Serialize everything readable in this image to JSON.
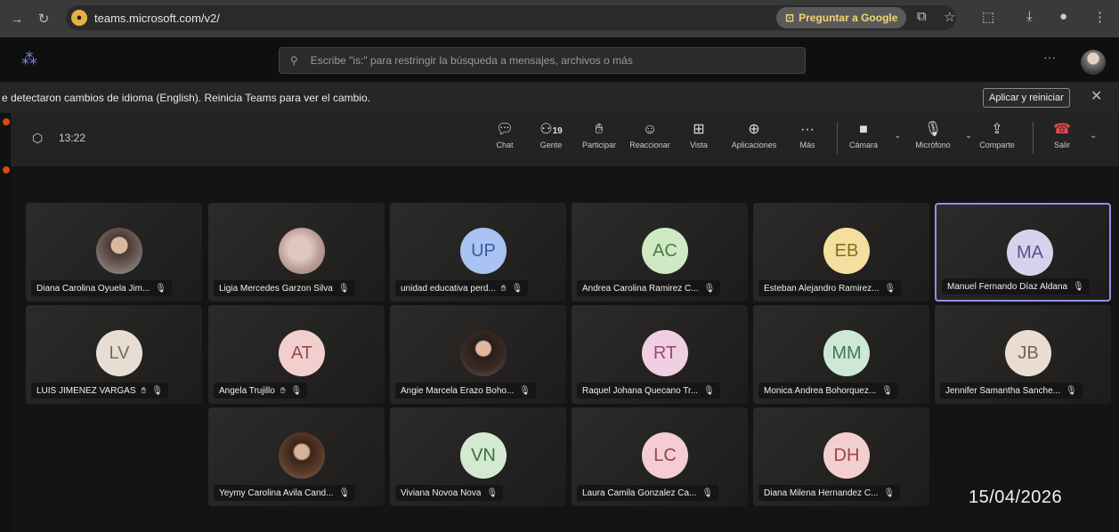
{
  "browser": {
    "url": "teams.microsoft.com/v2/",
    "google_button": "Preguntar a Google"
  },
  "teams": {
    "search_placeholder": "Escribe \"is:\" para restringir la búsqueda a mensajes, archivos o más",
    "more": "···"
  },
  "banner": {
    "message": "e detectaron cambios de idioma (English). Reinicia Teams para ver el cambio.",
    "apply_label": "Aplicar y reiniciar",
    "close": "✕"
  },
  "meeting": {
    "timer": "13:22",
    "controls": {
      "chat": "Chat",
      "people_count": "19",
      "people": "Gente",
      "raise": "Participar",
      "react": "Reaccionar",
      "view": "Vista",
      "apps": "Aplicaciones",
      "more": "Más",
      "camera": "Cámara",
      "mic": "Micrófono",
      "share": "Comparte",
      "leave": "Salir"
    }
  },
  "participants": [
    {
      "name": "Diana Carolina Oyuela Jim...",
      "avatar_type": "photo",
      "initials": "",
      "hand": false
    },
    {
      "name": "Ligia Mercedes Garzon Silva",
      "avatar_type": "photo2",
      "initials": "",
      "hand": false
    },
    {
      "name": "unidad educativa perd...",
      "avatar_type": "initials",
      "initials": "UP",
      "color": "#a9c3f2",
      "text_color": "#3a5a99",
      "hand": true
    },
    {
      "name": "Andrea Carolina Ramirez C...",
      "avatar_type": "initials",
      "initials": "AC",
      "color": "#cfe9c5",
      "text_color": "#4b7a3d",
      "hand": false
    },
    {
      "name": "Esteban Alejandro Ramirez...",
      "avatar_type": "initials",
      "initials": "EB",
      "color": "#f4df9e",
      "text_color": "#8a6d1e",
      "hand": false
    },
    {
      "name": "Manuel Fernando Díaz Aldana",
      "avatar_type": "initials",
      "initials": "MA",
      "color": "#d7d2ec",
      "text_color": "#5a4f8f",
      "hand": false,
      "active": true
    },
    {
      "name": "LUIS JIMENEZ VARGAS",
      "avatar_type": "initials",
      "initials": "LV",
      "color": "#e7ddd2",
      "text_color": "#7a6a58",
      "hand": true
    },
    {
      "name": "Angela Trujillo",
      "avatar_type": "initials",
      "initials": "AT",
      "color": "#f2cfcf",
      "text_color": "#9a4a4a",
      "hand": true
    },
    {
      "name": "Angie Marcela Erazo Boho...",
      "avatar_type": "photo3",
      "initials": "",
      "hand": false
    },
    {
      "name": "Raquel Johana Quecano Tr...",
      "avatar_type": "initials",
      "initials": "RT",
      "color": "#f1cfe2",
      "text_color": "#964877",
      "hand": false
    },
    {
      "name": "Monica Andrea Bohorquez...",
      "avatar_type": "initials",
      "initials": "MM",
      "color": "#cfe7d6",
      "text_color": "#3f7a55",
      "hand": false
    },
    {
      "name": "Jennifer Samantha Sanche...",
      "avatar_type": "initials",
      "initials": "JB",
      "color": "#e9ddd1",
      "text_color": "#7a6450",
      "hand": false
    },
    {
      "name": "Yeymy Carolina Avila Cand...",
      "avatar_type": "photo4",
      "initials": "",
      "hand": false
    },
    {
      "name": "Viviana Novoa Nova",
      "avatar_type": "initials",
      "initials": "VN",
      "color": "#d3ead1",
      "text_color": "#3d6e3a",
      "hand": false
    },
    {
      "name": "Laura Camila Gonzalez Ca...",
      "avatar_type": "initials",
      "initials": "LC",
      "color": "#f3cdd3",
      "text_color": "#9a3e4e",
      "hand": false
    },
    {
      "name": "Diana Milena Hernandez C...",
      "avatar_type": "initials",
      "initials": "DH",
      "color": "#f3d0d0",
      "text_color": "#9a4646",
      "hand": false
    }
  ],
  "overlay_date": "15/04/2026"
}
